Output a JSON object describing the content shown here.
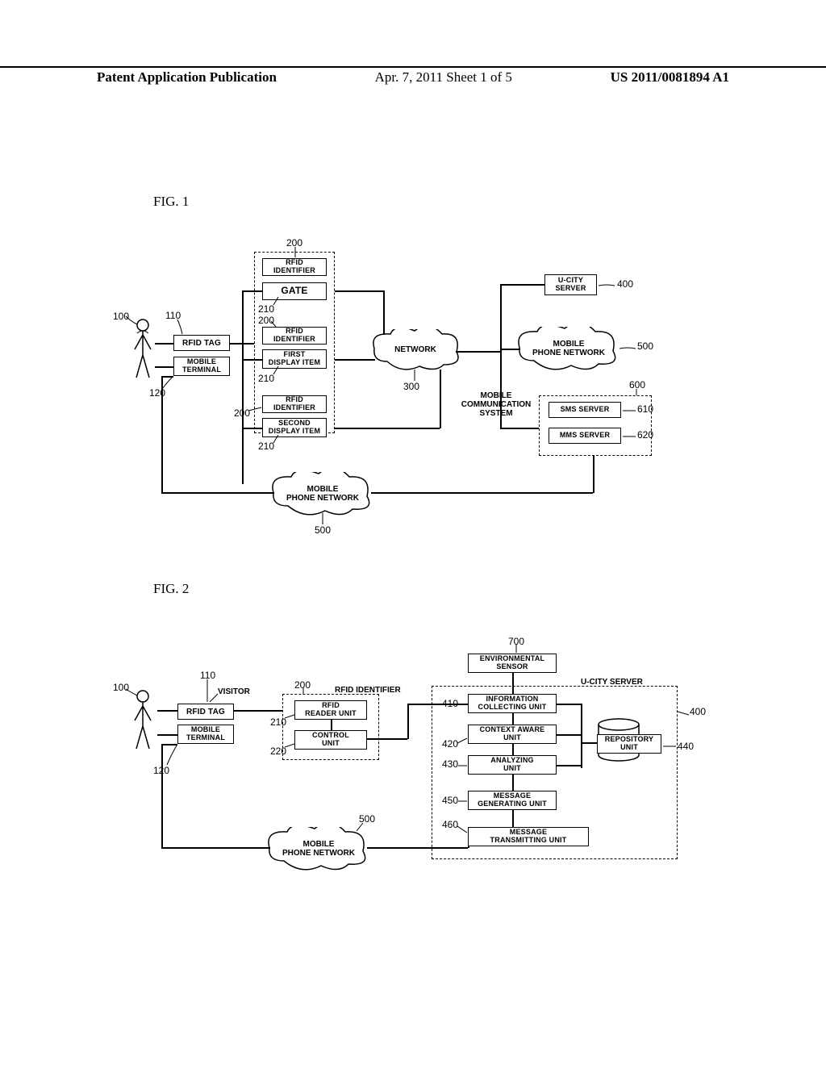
{
  "header": {
    "left": "Patent Application Publication",
    "center": "Apr. 7, 2011  Sheet 1 of 5",
    "right": "US 2011/0081894 A1"
  },
  "fig1": {
    "label": "FIG. 1",
    "refs": {
      "r100": "100",
      "r110": "110",
      "r120": "120",
      "r200a": "200",
      "r200b": "200",
      "r200c": "200",
      "r210a": "210",
      "r210b": "210",
      "r210c": "210",
      "r300": "300",
      "r400": "400",
      "r500a": "500",
      "r500b": "500",
      "r600": "600",
      "r610": "610",
      "r620": "620"
    },
    "boxes": {
      "rfid_tag": "RFID TAG",
      "mobile_terminal": "MOBILE\nTERMINAL",
      "rfid_id_top": "RFID\nIDENTIFIER",
      "gate": "GATE",
      "rfid_id_mid": "RFID\nIDENTIFIER",
      "first_display": "FIRST\nDISPLAY ITEM",
      "rfid_id_bot": "RFID\nIDENTIFIER",
      "second_display": "SECOND\nDISPLAY ITEM",
      "ucity": "U-CITY\nSERVER",
      "sms": "SMS SERVER",
      "mms": "MMS SERVER",
      "network": "NETWORK",
      "mobile_net1": "MOBILE\nPHONE NETWORK",
      "mobile_net2": "MOBILE\nPHONE NETWORK",
      "mobile_comm": "MOBILE\nCOMMUNICATION\nSYSTEM"
    }
  },
  "fig2": {
    "label": "FIG. 2",
    "refs": {
      "r100": "100",
      "r110": "110",
      "r120": "120",
      "r200": "200",
      "r210": "210",
      "r220": "220",
      "r400": "400",
      "r410": "410",
      "r420": "420",
      "r430": "430",
      "r440": "440",
      "r450": "450",
      "r460": "460",
      "r500": "500",
      "r700": "700"
    },
    "labels": {
      "visitor": "VISITOR",
      "rfid_identifier": "RFID IDENTIFIER",
      "ucity_server": "U-CITY SERVER"
    },
    "boxes": {
      "rfid_tag": "RFID TAG",
      "mobile_terminal": "MOBILE\nTERMINAL",
      "rfid_reader": "RFID\nREADER UNIT",
      "control_unit": "CONTROL\nUNIT",
      "env_sensor": "ENVIRONMENTAL\nSENSOR",
      "info_collect": "INFORMATION\nCOLLECTING UNIT",
      "context_aware": "CONTEXT AWARE\nUNIT",
      "analyzing": "ANALYZING\nUNIT",
      "repository": "REPOSITORY\nUNIT",
      "msg_gen": "MESSAGE\nGENERATING UNIT",
      "msg_trans": "MESSAGE\nTRANSMITTING UNIT",
      "mobile_net": "MOBILE\nPHONE NETWORK"
    }
  }
}
